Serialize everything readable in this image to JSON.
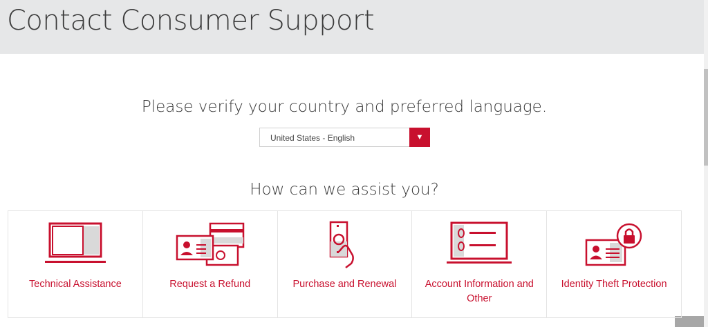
{
  "header": {
    "title": "Contact Consumer Support"
  },
  "verify": {
    "heading": "Please verify your country and preferred language.",
    "selected_option": "United States - English",
    "arrow_glyph": "▼"
  },
  "assist": {
    "heading": "How can we assist you?",
    "cards": [
      {
        "label": "Technical Assistance",
        "icon": "laptop-icon"
      },
      {
        "label": "Request a Refund",
        "icon": "refund-icon"
      },
      {
        "label": "Purchase and Renewal",
        "icon": "money-hand-icon"
      },
      {
        "label": "Account Information and Other",
        "icon": "account-info-icon"
      },
      {
        "label": "Identity Theft Protection",
        "icon": "identity-lock-icon"
      }
    ]
  },
  "colors": {
    "accent": "#c8102e",
    "header_bg": "#e6e7e8",
    "icon_fill": "#d9d9d9"
  }
}
